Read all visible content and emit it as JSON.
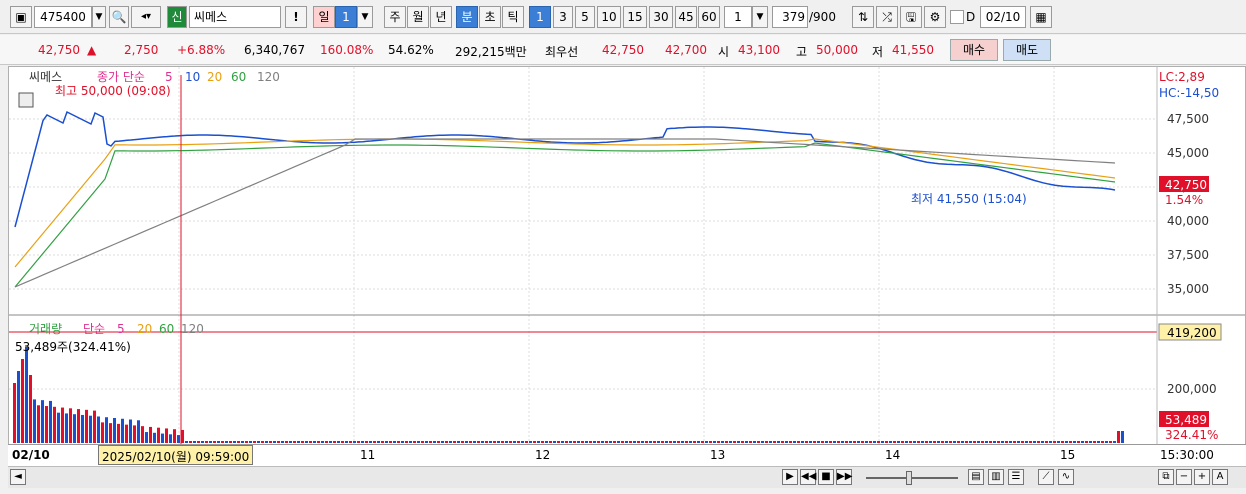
{
  "toolbar": {
    "code": "475400",
    "name_tag": "신",
    "name": "씨메스",
    "excl": "!",
    "periods": [
      "일",
      "1",
      "주",
      "월",
      "년",
      "분",
      "초",
      "틱"
    ],
    "minutes": [
      "1",
      "3",
      "5",
      "10",
      "15",
      "30",
      "45",
      "60"
    ],
    "interval": "1",
    "count": "379",
    "max": "/900",
    "date_flag": "D",
    "date": "02/10"
  },
  "quote": {
    "price": "42,750",
    "arrow": "▲",
    "change": "2,750",
    "rate": "+6.88%",
    "volume": "6,340,767",
    "vol_ratio": "160.08%",
    "turnover": "54.62%",
    "amount": "292,215백만",
    "best_label": "최우선",
    "best_ask": "42,750",
    "best_bid": "42,700",
    "open_label": "시",
    "open": "43,100",
    "high_label": "고",
    "high": "50,000",
    "low_label": "저",
    "low": "41,550",
    "buy": "매수",
    "sell": "매도"
  },
  "price_panel": {
    "name": "씨메스",
    "ma_label": "종가 단순",
    "ma_periods": [
      "5",
      "10",
      "20",
      "60",
      "120"
    ],
    "max_label": "최고 50,000 (09:08)",
    "min_label": "최저 41,550 (15:04)",
    "lc": "LC:2,89",
    "hc": "HC:-14,50",
    "y_ticks": [
      "47,500",
      "45,000",
      "42,500",
      "40,000",
      "37,500",
      "35,000"
    ],
    "current": "42,750",
    "current_pct": "1.54%"
  },
  "volume_panel": {
    "title": "거래량",
    "ma_label": "단순",
    "ma_periods": [
      "5",
      "20",
      "60",
      "120"
    ],
    "info": "53,489주(324.41%)",
    "max_value": "419,200",
    "tick": "200,000",
    "current": "53,489",
    "current_pct": "324.41%"
  },
  "x_axis": {
    "start": "02/10",
    "cursor": "2025/02/10(월) 09:59:00",
    "days": [
      "11",
      "12",
      "13",
      "14",
      "15"
    ],
    "end": "15:30:00"
  },
  "colors": {
    "up": "#e0102a",
    "down": "#1a4fd0",
    "ma5": "#e03090",
    "ma10": "#2050d0",
    "ma20": "#e8a010",
    "ma60": "#30a040",
    "ma120": "#808080"
  }
}
